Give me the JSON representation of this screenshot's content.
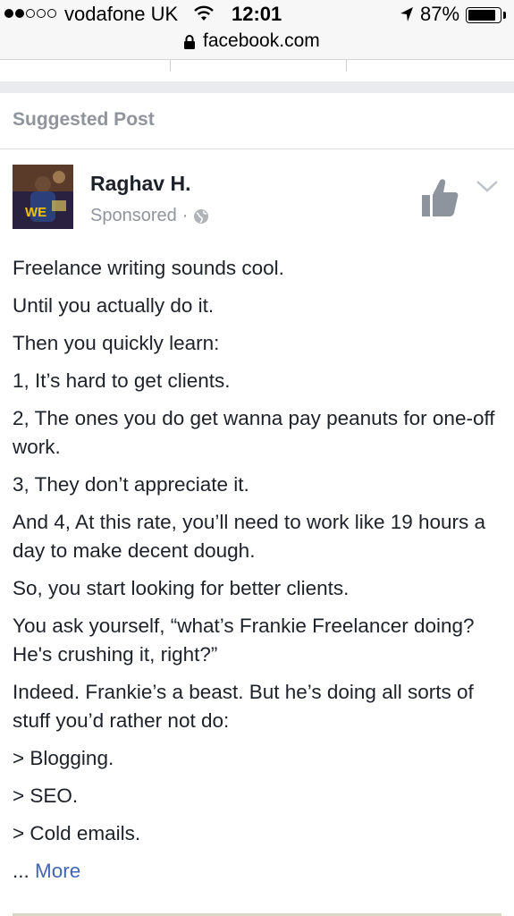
{
  "status_bar": {
    "carrier": "vodafone UK",
    "time": "12:01",
    "battery_percent_text": "87%",
    "battery_level": 0.87,
    "signal_bars_filled": 2,
    "signal_bars_total": 5
  },
  "browser": {
    "url": "facebook.com"
  },
  "post": {
    "section_label": "Suggested Post",
    "author": "Raghav H.",
    "sponsored": "Sponsored",
    "meta_separator": "·",
    "paragraphs": [
      "Freelance writing sounds cool.",
      "Until you actually do it.",
      "Then you quickly learn:",
      "1, It’s hard to get clients.",
      "2, The ones you do get wanna pay peanuts for one-off work.",
      "3, They don’t appreciate it.",
      "And 4, At this rate, you’ll need to work like 19 hours a day to make decent dough.",
      "So, you start looking for better clients.",
      "You ask yourself, “what’s Frankie Freelancer doing? He's crushing it, right?”",
      "Indeed. Frankie’s a beast. But he’s doing all sorts of stuff you’d rather not do:",
      "> Blogging.",
      "> SEO.",
      "> Cold emails."
    ],
    "ellipsis": "...",
    "more_label": "More",
    "icons": {
      "like": "thumbs-up-icon",
      "menu": "chevron-down-icon",
      "privacy": "globe-icon",
      "secure": "lock-icon"
    }
  },
  "colors": {
    "link": "#4267b2",
    "muted": "#90949c",
    "text": "#1d2129"
  }
}
